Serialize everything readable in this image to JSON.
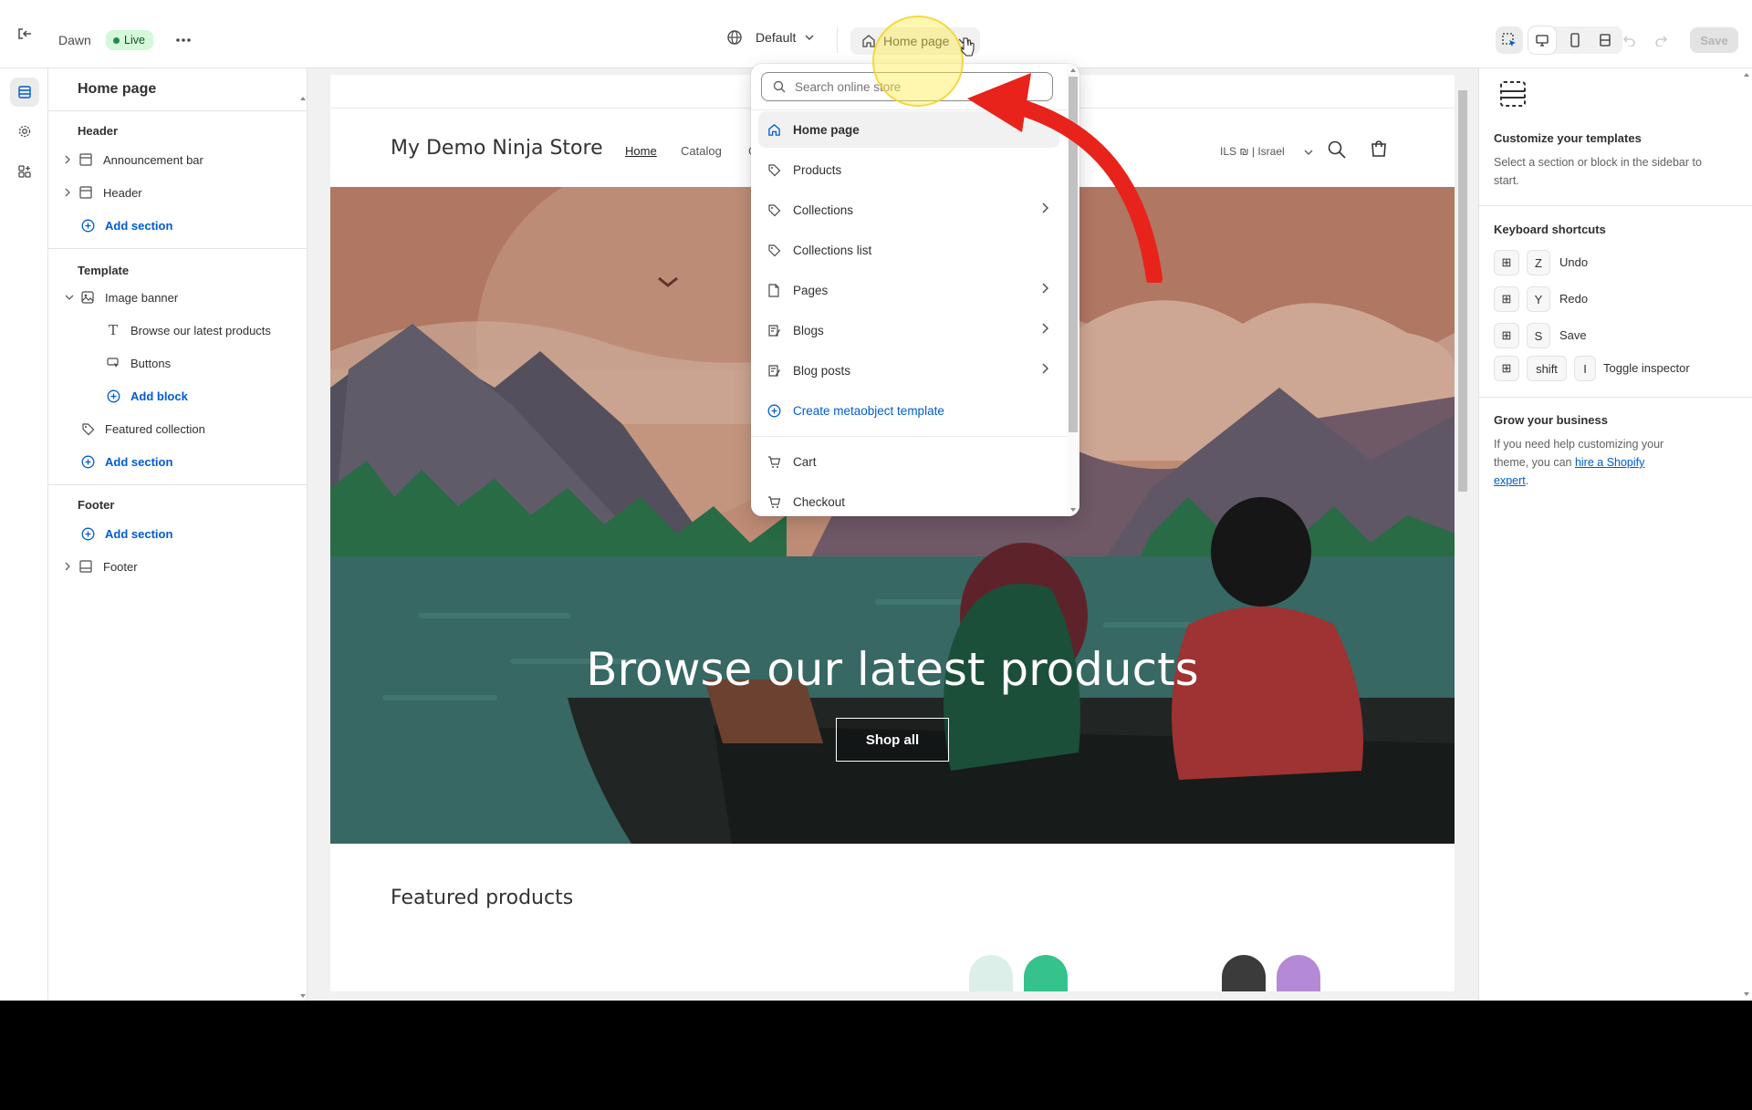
{
  "topbar": {
    "theme_name": "Dawn",
    "live_badge": "Live",
    "locale_label": "Default",
    "page_selector_label": "Home page",
    "save_label": "Save"
  },
  "sidebar": {
    "title": "Home page",
    "header_group": "Header",
    "announcement_bar": "Announcement bar",
    "header_item": "Header",
    "add_section": "Add section",
    "template_group": "Template",
    "image_banner": "Image banner",
    "browse_block": "Browse our latest products",
    "buttons_block": "Buttons",
    "add_block": "Add block",
    "featured_collection": "Featured collection",
    "footer_group": "Footer",
    "footer_item": "Footer"
  },
  "store": {
    "name": "My Demo Ninja Store",
    "nav": [
      "Home",
      "Catalog",
      "C"
    ],
    "currency": "ILS ₪ | Israel",
    "banner_heading": "Browse our latest products",
    "shop_all": "Shop all",
    "featured_heading": "Featured products"
  },
  "dropdown": {
    "search_placeholder": "Search online store",
    "items": [
      {
        "label": "Home page",
        "icon": "home-icon"
      },
      {
        "label": "Products",
        "icon": "tag-icon"
      },
      {
        "label": "Collections",
        "icon": "tag-icon"
      },
      {
        "label": "Collections list",
        "icon": "tag-icon"
      },
      {
        "label": "Pages",
        "icon": "page-icon"
      },
      {
        "label": "Blogs",
        "icon": "blog-icon"
      },
      {
        "label": "Blog posts",
        "icon": "blog-icon"
      },
      {
        "label": "Create metaobject template",
        "icon": "plus-circle-icon"
      },
      {
        "label": "Cart",
        "icon": "cart-icon"
      },
      {
        "label": "Checkout",
        "icon": "cart-icon"
      }
    ]
  },
  "rightpanel": {
    "customize_title": "Customize your templates",
    "customize_text": "Select a section or block in the sidebar to start.",
    "shortcuts_title": "Keyboard shortcuts",
    "shortcuts": [
      {
        "key": "Z",
        "label": "Undo"
      },
      {
        "key": "Y",
        "label": "Redo"
      },
      {
        "key": "S",
        "label": "Save"
      }
    ],
    "inspector_key1": "shift",
    "inspector_key2": "I",
    "inspector_label": "Toggle inspector",
    "grow_title": "Grow your business",
    "grow_text_1": "If you need help customizing your",
    "grow_text_2": "theme, you can ",
    "grow_link_1": "hire a Shopify",
    "grow_link_2": "expert",
    "grow_end": "."
  },
  "colors": {
    "accent": "#005bd3",
    "live_bg": "#d4f8d8",
    "live_text": "#0c5132",
    "arrow": "#e8231b"
  }
}
